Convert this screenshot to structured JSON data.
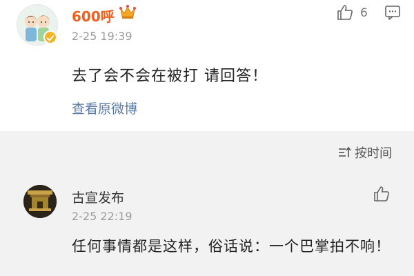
{
  "post": {
    "username": "600呼",
    "time": "2-25 19:39",
    "text": "去了会不会在被打 请回答！",
    "view_original": "查看原微博",
    "like_count": "6",
    "icons": {
      "avatar": "cartoon-couple-avatar",
      "badge": "verified-badge-icon",
      "crown": "crown-icon",
      "like": "thumbs-up-icon",
      "comment": "comment-icon"
    }
  },
  "sort": {
    "label": "按时间",
    "icon": "sort-icon"
  },
  "reply": {
    "username": "古宣发布",
    "time": "2-25 22:19",
    "text": "任何事情都是这样，俗话说：一个巴掌拍不响！",
    "icons": {
      "avatar": "gugong-logo-avatar",
      "like": "thumbs-up-icon"
    }
  },
  "colors": {
    "username": "#f0601d",
    "link": "#5b7ba7",
    "muted": "#9a9a9a",
    "background": "#f2f2f2"
  }
}
